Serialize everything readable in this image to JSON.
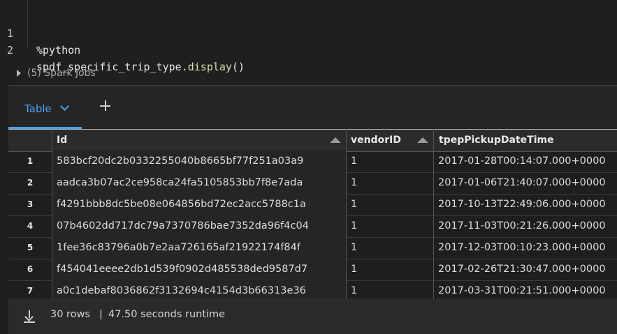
{
  "editor": {
    "lines": [
      {
        "number": "1",
        "text": "%python"
      },
      {
        "number": "2",
        "prefix": "spdf_specific_trip_type.",
        "func": "display",
        "suffix": "()"
      }
    ]
  },
  "spark_jobs_label": "(5) Spark Jobs",
  "tabs": {
    "active_label": "Table",
    "add_icon": "plus-icon"
  },
  "table": {
    "columns": [
      "Id",
      "vendorID",
      "tpepPickupDateTime"
    ],
    "rows": [
      {
        "n": "1",
        "id": "583bcf20dc2b0332255040b8665bf77f251a03a9",
        "vendor": "1",
        "pickup": "2017-01-28T00:14:07.000+0000"
      },
      {
        "n": "2",
        "id": "aadca3b07ac2ce958ca24fa5105853bb7f8e7ada",
        "vendor": "1",
        "pickup": "2017-01-06T21:40:07.000+0000"
      },
      {
        "n": "3",
        "id": "f4291bbb8dc5be08e064856bd72ec2acc5788c1a",
        "vendor": "1",
        "pickup": "2017-10-13T22:49:06.000+0000"
      },
      {
        "n": "4",
        "id": "07b4602dd717dc79a7370786bae7352da96f4c04",
        "vendor": "1",
        "pickup": "2017-11-03T00:21:26.000+0000"
      },
      {
        "n": "5",
        "id": "1fee36c83796a0b7e2aa726165af21922174f84f",
        "vendor": "1",
        "pickup": "2017-12-03T00:10:23.000+0000"
      },
      {
        "n": "6",
        "id": "f454041eeee2db1d539f0902d485538ded9587d7",
        "vendor": "1",
        "pickup": "2017-02-26T21:30:47.000+0000"
      },
      {
        "n": "7",
        "id": "a0c1debaf8036862f3132694c4154d3b66313e36",
        "vendor": "1",
        "pickup": "2017-03-31T00:21:51.000+0000"
      }
    ]
  },
  "footer": {
    "rows_count": "30 rows",
    "separator": "|",
    "runtime": "47.50 seconds runtime",
    "download_icon": "download-icon"
  }
}
